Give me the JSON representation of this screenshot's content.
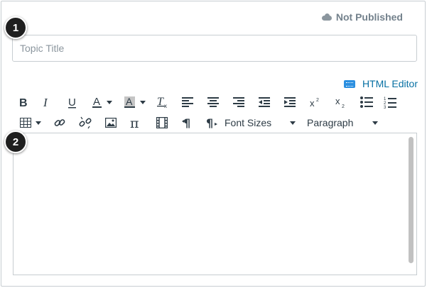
{
  "status": {
    "label": "Not Published",
    "icon": "cloud-icon"
  },
  "title_field": {
    "placeholder": "Topic Title",
    "value": ""
  },
  "callouts": {
    "one": "1",
    "two": "2"
  },
  "html_editor": {
    "label": "HTML Editor",
    "icon": "keyboard-icon"
  },
  "toolbar": {
    "font_sizes": "Font Sizes",
    "paragraph": "Paragraph"
  },
  "colors": {
    "link": "#0770a3",
    "border": "#c7cdd1",
    "muted": "#73818c",
    "callout": "#1f1f1f"
  }
}
